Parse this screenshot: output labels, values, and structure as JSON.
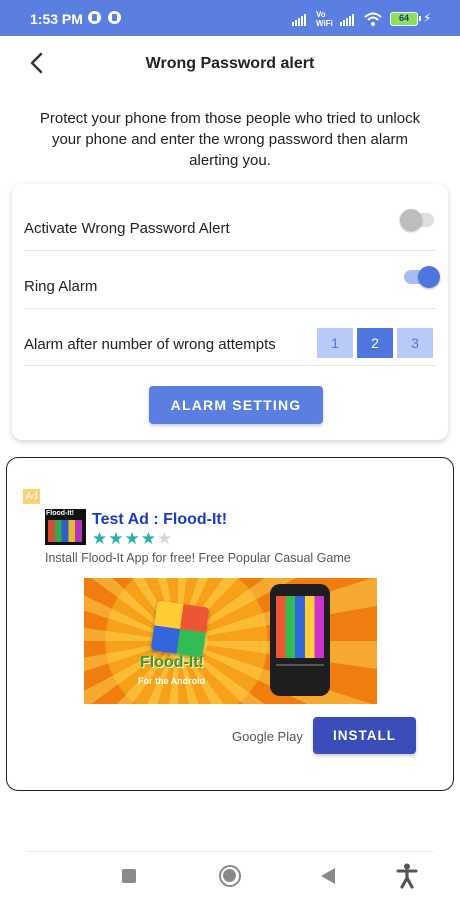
{
  "status_bar": {
    "time": "1:53 PM",
    "volte_line1": "Vo",
    "volte_line2": "WiFi",
    "battery": "64",
    "charging_glyph": "⚡"
  },
  "header": {
    "title": "Wrong Password alert"
  },
  "description": "Protect your phone from those people who tried to unlock your phone and enter the wrong password then alarm alerting you.",
  "settings": {
    "activate_label": "Activate Wrong Password Alert",
    "activate_enabled": false,
    "ring_label": "Ring Alarm",
    "ring_enabled": true,
    "attempts_label": "Alarm after number of wrong attempts",
    "attempt_options": [
      "1",
      "2",
      "3"
    ],
    "selected_attempt": "2",
    "button_label": "ALARM SETTING"
  },
  "ad": {
    "badge": "Ad",
    "icon_text": "Flood-It!",
    "title": "Test Ad : Flood-It!",
    "rating": 4,
    "rating_max": 5,
    "description": "Install Flood-It App for free! Free Popular Casual Game",
    "image_logo": "Flood-It!",
    "image_subtitle": "For the Android",
    "store": "Google Play",
    "install_label": "INSTALL"
  },
  "colors": {
    "status_bar": "#5b7fe0",
    "accent": "#4f75df",
    "install": "#3b4db8",
    "ad_title": "#1b3bb8",
    "star": "#21b5a6"
  },
  "icons": [
    "back-arrow-icon",
    "wifi-icon",
    "signal-icon",
    "battery-icon",
    "nav-recents-icon",
    "nav-home-icon",
    "nav-back-icon",
    "accessibility-icon"
  ]
}
